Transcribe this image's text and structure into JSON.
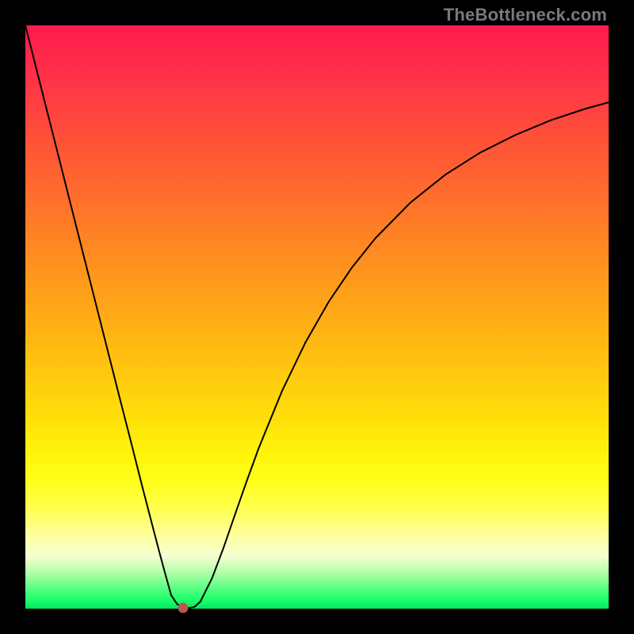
{
  "watermark": "TheBottleneck.com",
  "colors": {
    "frame": "#000000",
    "curve": "#000000",
    "dot": "#b65a4e"
  },
  "chart_data": {
    "type": "line",
    "title": "",
    "xlabel": "",
    "ylabel": "",
    "xlim": [
      0,
      100
    ],
    "ylim": [
      0,
      100
    ],
    "grid": false,
    "legend": false,
    "annotations": [
      "TheBottleneck.com"
    ],
    "series": [
      {
        "name": "bottleneck-curve",
        "x": [
          0,
          2,
          4,
          6,
          8,
          10,
          12,
          14,
          16,
          18,
          20,
          22,
          23,
          24,
          25,
          26,
          27,
          28,
          29,
          30,
          32,
          34,
          36,
          38,
          40,
          44,
          48,
          52,
          56,
          60,
          66,
          72,
          78,
          84,
          90,
          96,
          100
        ],
        "y": [
          100,
          92.1,
          84.2,
          76.3,
          68.4,
          60.5,
          52.6,
          44.7,
          36.8,
          29.0,
          21.1,
          13.4,
          9.6,
          5.9,
          2.3,
          0.8,
          0.2,
          0.1,
          0.3,
          1.2,
          5.2,
          10.5,
          16.3,
          22.0,
          27.5,
          37.3,
          45.6,
          52.6,
          58.5,
          63.5,
          69.6,
          74.4,
          78.2,
          81.2,
          83.7,
          85.7,
          86.8
        ]
      }
    ],
    "marker": {
      "x": 27,
      "y": 0.1
    },
    "background_gradient": {
      "top": "#ff1a4d",
      "mid": "#ffc90e",
      "bottom": "#00e860"
    }
  }
}
